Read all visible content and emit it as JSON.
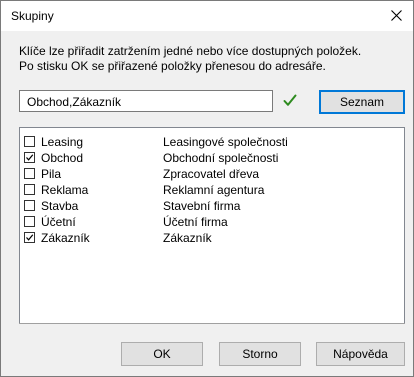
{
  "window": {
    "title": "Skupiny"
  },
  "description": {
    "line1": "Klíče lze přiřadit zatržením jedné nebo více dostupných položek.",
    "line2": "Po stisku OK se přiřazené položky přenesou do adresáře."
  },
  "input": {
    "value": "Obchod,Zákazník"
  },
  "buttons": {
    "seznam": "Seznam",
    "ok": "OK",
    "storno": "Storno",
    "napoveda": "Nápověda"
  },
  "items": [
    {
      "name": "Leasing",
      "description": "Leasingové společnosti",
      "checked": false
    },
    {
      "name": "Obchod",
      "description": "Obchodní společnosti",
      "checked": true
    },
    {
      "name": "Pila",
      "description": "Zpracovatel dřeva",
      "checked": false
    },
    {
      "name": "Reklama",
      "description": "Reklamní agentura",
      "checked": false
    },
    {
      "name": "Stavba",
      "description": "Stavební firma",
      "checked": false
    },
    {
      "name": "Účetní",
      "description": "Účetní firma",
      "checked": false
    },
    {
      "name": "Zákazník",
      "description": "Zákazník",
      "checked": true
    }
  ],
  "colors": {
    "accent": "#0078d7",
    "valid_check": "#2e8b1f"
  }
}
